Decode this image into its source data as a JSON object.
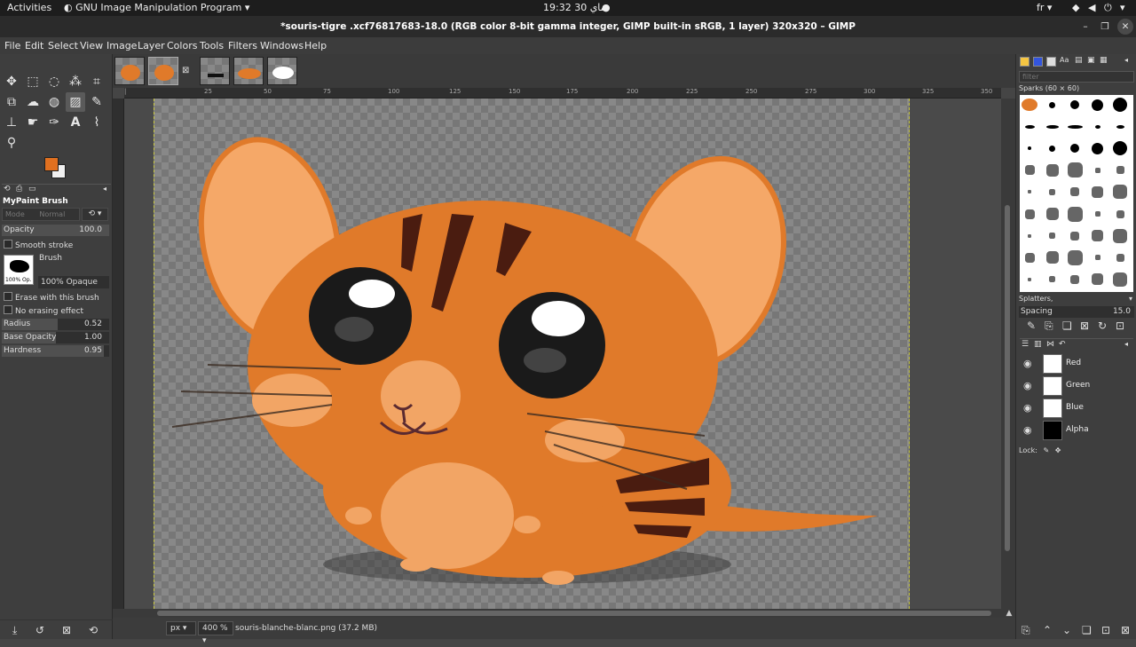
{
  "topbar": {
    "activities": "Activities",
    "app_name": "GNU Image Manipulation Program",
    "clock": "19:32  ماي 30",
    "keyboard_layout": "fr"
  },
  "window": {
    "title": "*souris-tigre .xcf76817683-18.0 (RGB color 8-bit gamma integer, GIMP built-in sRGB, 1 layer) 320x320 – GIMP"
  },
  "menu": [
    "File",
    "Edit",
    "Select",
    "View",
    "Image",
    "Layer",
    "Colors",
    "Tools",
    "Filters",
    "Windows",
    "Help"
  ],
  "tool_options": {
    "title": "MyPaint Brush",
    "mode_label": "Mode",
    "mode_value": "Normal",
    "opacity_label": "Opacity",
    "opacity_value": "100.0",
    "smooth_stroke": "Smooth stroke",
    "brush_label": "Brush",
    "brush_thumb_label": "100% Op.",
    "brush_name": "100% Opaque",
    "erase_label": "Erase with this brush",
    "no_erasing": "No erasing effect",
    "radius_label": "Radius",
    "radius_value": "0.52",
    "radius_level": 0.52,
    "base_opacity_label": "Base Opacity",
    "base_opacity_value": "1.00",
    "base_opacity_level": 0.5,
    "hardness_label": "Hardness",
    "hardness_value": "0.95",
    "hardness_level": 0.95
  },
  "colors": {
    "foreground": "#e07020",
    "background": "#f0f0f0",
    "accent_orange": "#e07a2a"
  },
  "ruler_ticks": [
    "25",
    "50",
    "75",
    "100",
    "125",
    "150",
    "175",
    "200",
    "225",
    "250",
    "275",
    "300",
    "325",
    "350"
  ],
  "status": {
    "unit": "px",
    "zoom": "400 %",
    "filename": "souris-blanche-blanc.png (37.2 MB)"
  },
  "brushes": {
    "filter_placeholder": "filter",
    "title": "Sparks (60 × 60)",
    "selected_tag": "Splatters,",
    "spacing_label": "Spacing",
    "spacing_value": "15.0"
  },
  "channels": {
    "items": [
      {
        "name": "Red"
      },
      {
        "name": "Green"
      },
      {
        "name": "Blue"
      },
      {
        "name": "Alpha"
      }
    ],
    "lock_label": "Lock:"
  }
}
